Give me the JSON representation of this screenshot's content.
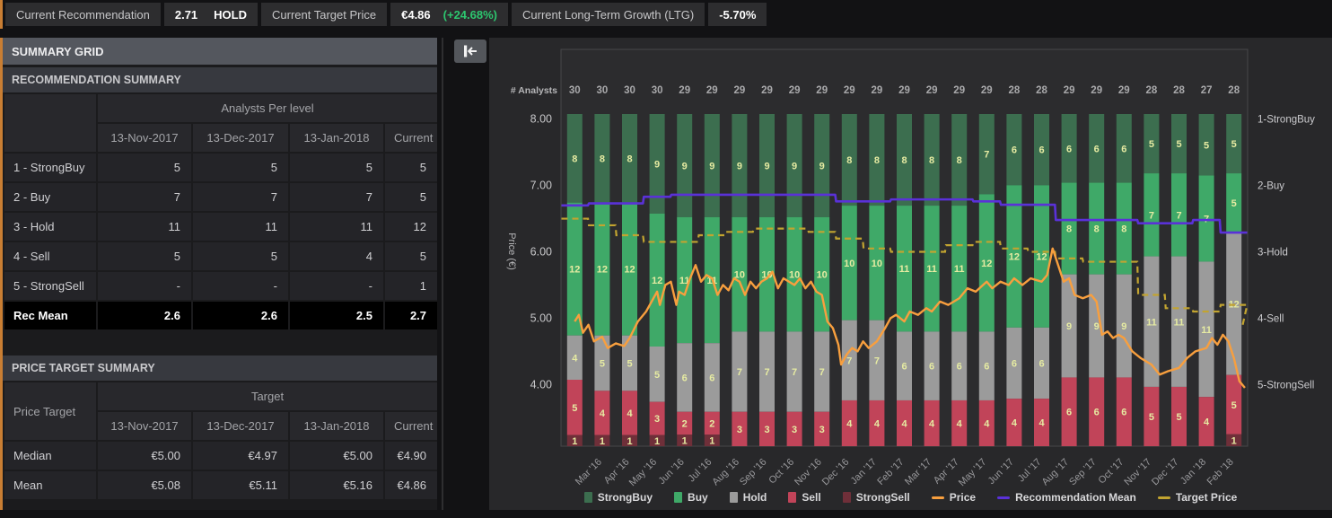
{
  "top_bar": {
    "recommendation_label": "Current Recommendation",
    "recommendation_value": "2.71",
    "recommendation_text": "HOLD",
    "target_price_label": "Current Target Price",
    "target_price_value": "€4.86",
    "target_price_change": "(+24.68%)",
    "ltg_label": "Current Long-Term Growth (LTG)",
    "ltg_value": "-5.70%"
  },
  "summary_grid": {
    "title": "SUMMARY GRID",
    "recommendation_summary": {
      "title": "RECOMMENDATION SUMMARY",
      "group_header": "Analysts Per level",
      "columns": [
        "13-Nov-2017",
        "13-Dec-2017",
        "13-Jan-2018",
        "Current"
      ],
      "rows": [
        {
          "label": "1 - StrongBuy",
          "values": [
            "5",
            "5",
            "5",
            "5"
          ]
        },
        {
          "label": "2 - Buy",
          "values": [
            "7",
            "7",
            "7",
            "5"
          ]
        },
        {
          "label": "3 - Hold",
          "values": [
            "11",
            "11",
            "11",
            "12"
          ]
        },
        {
          "label": "4 - Sell",
          "values": [
            "5",
            "5",
            "4",
            "5"
          ]
        },
        {
          "label": "5 - StrongSell",
          "values": [
            "-",
            "-",
            "-",
            "1"
          ]
        }
      ],
      "footer": {
        "label": "Rec Mean",
        "values": [
          "2.6",
          "2.6",
          "2.5",
          "2.7"
        ]
      }
    },
    "price_target_summary": {
      "title": "PRICE TARGET SUMMARY",
      "row_header": "Price Target",
      "group_header": "Target",
      "columns": [
        "13-Nov-2017",
        "13-Dec-2017",
        "13-Jan-2018",
        "Current"
      ],
      "rows": [
        {
          "label": "Median",
          "values": [
            "€5.00",
            "€4.97",
            "€5.00",
            "€4.90"
          ]
        },
        {
          "label": "Mean",
          "values": [
            "€5.08",
            "€5.11",
            "€5.16",
            "€4.86"
          ]
        }
      ]
    }
  },
  "collapse_button": {
    "icon": "collapse-left"
  },
  "chart_data": {
    "type": "composite",
    "subtype": "stacked-bar-with-lines",
    "analysts_row_label": "# Analysts",
    "ylabel": "Price (€)",
    "y_ticks": [
      8.0,
      7.0,
      6.0,
      5.0,
      4.0
    ],
    "right_axis_labels": [
      "1-StrongBuy",
      "2-Buy",
      "3-Hold",
      "4-Sell",
      "5-StrongSell"
    ],
    "bar_stack_order": [
      "strong_buy",
      "buy",
      "hold",
      "sell",
      "strong_sell"
    ],
    "bars": [
      {
        "month": "",
        "analysts": 30,
        "strong_buy": 8,
        "buy": 12,
        "hold": 4,
        "sell": 5,
        "strong_sell": 1
      },
      {
        "month": "Mar '16",
        "analysts": 30,
        "strong_buy": 8,
        "buy": 12,
        "hold": 5,
        "sell": 4,
        "strong_sell": 1
      },
      {
        "month": "Apr '16",
        "analysts": 30,
        "strong_buy": 8,
        "buy": 12,
        "hold": 5,
        "sell": 4,
        "strong_sell": 1
      },
      {
        "month": "May '16",
        "analysts": 30,
        "strong_buy": 9,
        "buy": 12,
        "hold": 5,
        "sell": 3,
        "strong_sell": 1
      },
      {
        "month": "Jun '16",
        "analysts": 29,
        "strong_buy": 9,
        "buy": 11,
        "hold": 6,
        "sell": 2,
        "strong_sell": 1
      },
      {
        "month": "Jul '16",
        "analysts": 29,
        "strong_buy": 9,
        "buy": 11,
        "hold": 6,
        "sell": 2,
        "strong_sell": 1
      },
      {
        "month": "Aug '16",
        "analysts": 29,
        "strong_buy": 9,
        "buy": 10,
        "hold": 7,
        "sell": 3,
        "strong_sell": 0
      },
      {
        "month": "Sep '16",
        "analysts": 29,
        "strong_buy": 9,
        "buy": 10,
        "hold": 7,
        "sell": 3,
        "strong_sell": 0
      },
      {
        "month": "Oct '16",
        "analysts": 29,
        "strong_buy": 9,
        "buy": 10,
        "hold": 7,
        "sell": 3,
        "strong_sell": 0
      },
      {
        "month": "Nov '16",
        "analysts": 29,
        "strong_buy": 9,
        "buy": 10,
        "hold": 7,
        "sell": 3,
        "strong_sell": 0
      },
      {
        "month": "Dec '16",
        "analysts": 29,
        "strong_buy": 8,
        "buy": 10,
        "hold": 7,
        "sell": 4,
        "strong_sell": 0
      },
      {
        "month": "Jan '17",
        "analysts": 29,
        "strong_buy": 8,
        "buy": 10,
        "hold": 7,
        "sell": 4,
        "strong_sell": 0
      },
      {
        "month": "Feb '17",
        "analysts": 29,
        "strong_buy": 8,
        "buy": 11,
        "hold": 6,
        "sell": 4,
        "strong_sell": 0
      },
      {
        "month": "Mar '17",
        "analysts": 29,
        "strong_buy": 8,
        "buy": 11,
        "hold": 6,
        "sell": 4,
        "strong_sell": 0
      },
      {
        "month": "Apr '17",
        "analysts": 29,
        "strong_buy": 8,
        "buy": 11,
        "hold": 6,
        "sell": 4,
        "strong_sell": 0
      },
      {
        "month": "May '17",
        "analysts": 29,
        "strong_buy": 7,
        "buy": 12,
        "hold": 6,
        "sell": 4,
        "strong_sell": 0
      },
      {
        "month": "Jun '17",
        "analysts": 28,
        "strong_buy": 6,
        "buy": 12,
        "hold": 6,
        "sell": 4,
        "strong_sell": 0
      },
      {
        "month": "Jul '17",
        "analysts": 28,
        "strong_buy": 6,
        "buy": 12,
        "hold": 6,
        "sell": 4,
        "strong_sell": 0
      },
      {
        "month": "Aug '17",
        "analysts": 29,
        "strong_buy": 6,
        "buy": 8,
        "hold": 9,
        "sell": 6,
        "strong_sell": 0
      },
      {
        "month": "Sep '17",
        "analysts": 29,
        "strong_buy": 6,
        "buy": 8,
        "hold": 9,
        "sell": 6,
        "strong_sell": 0
      },
      {
        "month": "Oct '17",
        "analysts": 29,
        "strong_buy": 6,
        "buy": 8,
        "hold": 9,
        "sell": 6,
        "strong_sell": 0
      },
      {
        "month": "Nov '17",
        "analysts": 28,
        "strong_buy": 5,
        "buy": 7,
        "hold": 11,
        "sell": 5,
        "strong_sell": 0
      },
      {
        "month": "Dec '17",
        "analysts": 28,
        "strong_buy": 5,
        "buy": 7,
        "hold": 11,
        "sell": 5,
        "strong_sell": 0
      },
      {
        "month": "Jan '18",
        "analysts": 27,
        "strong_buy": 5,
        "buy": 7,
        "hold": 11,
        "sell": 4,
        "strong_sell": 0
      },
      {
        "month": "Feb '18",
        "analysts": 28,
        "strong_buy": 5,
        "buy": 5,
        "hold": 12,
        "sell": 5,
        "strong_sell": 1
      }
    ],
    "series": {
      "price": [
        [
          0,
          4.95
        ],
        [
          0.15,
          5.05
        ],
        [
          0.3,
          4.78
        ],
        [
          0.5,
          4.9
        ],
        [
          0.7,
          4.65
        ],
        [
          1,
          4.72
        ],
        [
          1.2,
          4.55
        ],
        [
          1.5,
          4.62
        ],
        [
          1.8,
          4.58
        ],
        [
          2,
          4.7
        ],
        [
          2.3,
          4.95
        ],
        [
          2.6,
          5.1
        ],
        [
          2.8,
          5.25
        ],
        [
          3,
          5.4
        ],
        [
          3.1,
          5.2
        ],
        [
          3.3,
          5.5
        ],
        [
          3.5,
          5.55
        ],
        [
          3.7,
          5.2
        ],
        [
          3.8,
          5.4
        ],
        [
          4,
          5.35
        ],
        [
          4.2,
          5.6
        ],
        [
          4.4,
          5.8
        ],
        [
          4.6,
          5.55
        ],
        [
          4.8,
          5.65
        ],
        [
          5,
          5.6
        ],
        [
          5.2,
          5.35
        ],
        [
          5.4,
          5.5
        ],
        [
          5.6,
          5.42
        ],
        [
          5.8,
          5.6
        ],
        [
          6,
          5.55
        ],
        [
          6.2,
          5.35
        ],
        [
          6.4,
          5.55
        ],
        [
          6.6,
          5.45
        ],
        [
          6.8,
          5.55
        ],
        [
          7,
          5.6
        ],
        [
          7.2,
          5.7
        ],
        [
          7.4,
          5.45
        ],
        [
          7.6,
          5.6
        ],
        [
          7.8,
          5.55
        ],
        [
          8,
          5.5
        ],
        [
          8.2,
          5.6
        ],
        [
          8.4,
          5.45
        ],
        [
          8.6,
          5.55
        ],
        [
          8.8,
          5.4
        ],
        [
          9,
          5.35
        ],
        [
          9.2,
          4.95
        ],
        [
          9.4,
          4.85
        ],
        [
          9.6,
          4.6
        ],
        [
          9.7,
          4.3
        ],
        [
          9.9,
          4.45
        ],
        [
          10.1,
          4.55
        ],
        [
          10.3,
          4.5
        ],
        [
          10.5,
          4.65
        ],
        [
          10.7,
          4.55
        ],
        [
          11,
          4.65
        ],
        [
          11.3,
          4.85
        ],
        [
          11.5,
          5.0
        ],
        [
          11.7,
          5.05
        ],
        [
          12,
          4.95
        ],
        [
          12.2,
          5.1
        ],
        [
          12.5,
          5.05
        ],
        [
          12.8,
          5.15
        ],
        [
          13,
          5.1
        ],
        [
          13.3,
          5.25
        ],
        [
          13.6,
          5.2
        ],
        [
          14,
          5.3
        ],
        [
          14.3,
          5.45
        ],
        [
          14.6,
          5.4
        ],
        [
          15,
          5.55
        ],
        [
          15.2,
          5.45
        ],
        [
          15.5,
          5.55
        ],
        [
          15.8,
          5.5
        ],
        [
          16,
          5.6
        ],
        [
          16.3,
          5.5
        ],
        [
          16.6,
          5.6
        ],
        [
          17,
          5.55
        ],
        [
          17.2,
          5.65
        ],
        [
          17.4,
          6.05
        ],
        [
          17.6,
          5.8
        ],
        [
          17.8,
          5.55
        ],
        [
          18,
          5.6
        ],
        [
          18.2,
          5.35
        ],
        [
          18.5,
          5.3
        ],
        [
          18.8,
          5.35
        ],
        [
          19,
          5.25
        ],
        [
          19.2,
          4.75
        ],
        [
          19.4,
          4.8
        ],
        [
          19.6,
          4.7
        ],
        [
          19.8,
          4.75
        ],
        [
          20,
          4.7
        ],
        [
          20.3,
          4.5
        ],
        [
          20.6,
          4.4
        ],
        [
          21,
          4.3
        ],
        [
          21.3,
          4.15
        ],
        [
          21.6,
          4.2
        ],
        [
          22,
          4.25
        ],
        [
          22.3,
          4.4
        ],
        [
          22.6,
          4.5
        ],
        [
          23,
          4.55
        ],
        [
          23.2,
          4.7
        ],
        [
          23.4,
          4.6
        ],
        [
          23.6,
          4.75
        ],
        [
          23.8,
          4.65
        ],
        [
          24,
          4.4
        ],
        [
          24.2,
          4.05
        ],
        [
          24.4,
          3.95
        ]
      ],
      "recommendation_mean": [
        2.3,
        2.27,
        2.27,
        2.17,
        2.14,
        2.14,
        2.14,
        2.14,
        2.14,
        2.14,
        2.24,
        2.24,
        2.21,
        2.21,
        2.21,
        2.24,
        2.29,
        2.29,
        2.52,
        2.52,
        2.52,
        2.57,
        2.57,
        2.52,
        2.71
      ],
      "target_price": [
        6.5,
        6.4,
        6.25,
        6.15,
        6.15,
        6.25,
        6.3,
        6.35,
        6.35,
        6.3,
        6.2,
        6.05,
        6.0,
        6.0,
        6.1,
        6.15,
        6.05,
        6.0,
        5.9,
        5.85,
        5.85,
        5.35,
        5.15,
        5.1,
        5.2
      ],
      "target_price_end": 4.87
    },
    "legend": [
      {
        "label": "StrongBuy",
        "swatch": "box",
        "color": "#3c6e4f"
      },
      {
        "label": "Buy",
        "swatch": "box",
        "color": "#3fa968"
      },
      {
        "label": "Hold",
        "swatch": "box",
        "color": "#9b9b9b"
      },
      {
        "label": "Sell",
        "swatch": "box",
        "color": "#c14459"
      },
      {
        "label": "StrongSell",
        "swatch": "box",
        "color": "#6f2f39"
      },
      {
        "label": "Price",
        "swatch": "line",
        "color": "#f89f3e"
      },
      {
        "label": "Recommendation Mean",
        "swatch": "line",
        "color": "#5a31d8"
      },
      {
        "label": "Target Price",
        "swatch": "line",
        "color": "#c2a430"
      }
    ],
    "colors": {
      "strong_buy": "#3c6e4f",
      "buy": "#3fa968",
      "hold": "#9b9b9b",
      "sell": "#c14459",
      "strong_sell": "#6f2f39",
      "price_line": "#f89f3e",
      "rec_mean_line": "#5a31d8",
      "target_line": "#c2a430",
      "bar_number": "#e6eba2",
      "analysts_text": "#a9a9ab"
    }
  }
}
